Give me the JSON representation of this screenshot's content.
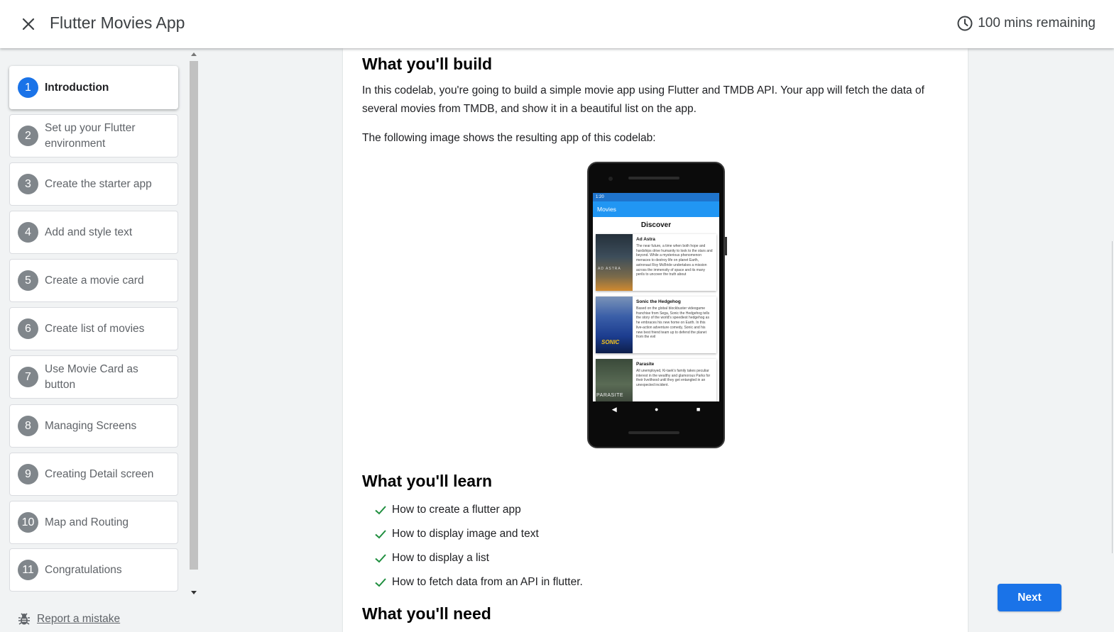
{
  "header": {
    "title": "Flutter Movies App",
    "timer": "100 mins remaining"
  },
  "sidebar": {
    "steps": [
      {
        "num": "1",
        "label": "Introduction",
        "active": true
      },
      {
        "num": "2",
        "label": "Set up your Flutter environment"
      },
      {
        "num": "3",
        "label": "Create the starter app"
      },
      {
        "num": "4",
        "label": "Add and style text"
      },
      {
        "num": "5",
        "label": "Create a movie card"
      },
      {
        "num": "6",
        "label": "Create list of movies"
      },
      {
        "num": "7",
        "label": "Use Movie Card as button"
      },
      {
        "num": "8",
        "label": "Managing Screens"
      },
      {
        "num": "9",
        "label": "Creating Detail screen"
      },
      {
        "num": "10",
        "label": "Map and Routing"
      },
      {
        "num": "11",
        "label": "Congratulations"
      }
    ],
    "report": "Report a mistake"
  },
  "content": {
    "build_heading": "What you'll build",
    "build_para": "In this codelab, you're going to build a simple movie app using Flutter and TMDB API. Your app will fetch the data of several movies from TMDB, and show it in a beautiful list on the app.",
    "image_caption": "The following image shows the resulting app of this codelab:",
    "learn_heading": "What you'll learn",
    "learn_items": [
      "How to create a flutter app",
      "How to display image and text",
      "How to display a list",
      "How to fetch data from an API in flutter."
    ],
    "need_heading": "What you'll need"
  },
  "phone": {
    "status_time": "1:20",
    "appbar_title": "Movies",
    "discover": "Discover",
    "movies": [
      {
        "title": "Ad Astra",
        "desc": "The near future, a time when both hope and hardships drive humanity to look to the stars and beyond. While a mysterious phenomenon menaces to destroy life on planet Earth, astronaut Roy McBride undertakes a mission across the immensity of space and its many perils to uncover the truth about",
        "poster_text": "AD ASTRA"
      },
      {
        "title": "Sonic the Hedgehog",
        "desc": "Based on the global blockbuster videogame franchise from Sega, Sonic the Hedgehog tells the story of the world's speediest hedgehog as he embraces his new home on Earth. In this live-action adventure comedy, Sonic and his new best friend team up to defend the planet from the evil",
        "poster_text": "SONIC"
      },
      {
        "title": "Parasite",
        "desc": "All unemployed, Ki-taek's family takes peculiar interest in the wealthy and glamorous Parks for their livelihood until they get entangled in an unexpected incident.",
        "poster_text": "PARASITE"
      }
    ],
    "nav": [
      "◀",
      "●",
      "■"
    ]
  },
  "next_button": "Next",
  "colors": {
    "accent": "#1a73e8",
    "check": "#1e8e3e",
    "appbar": "#2196f3"
  }
}
